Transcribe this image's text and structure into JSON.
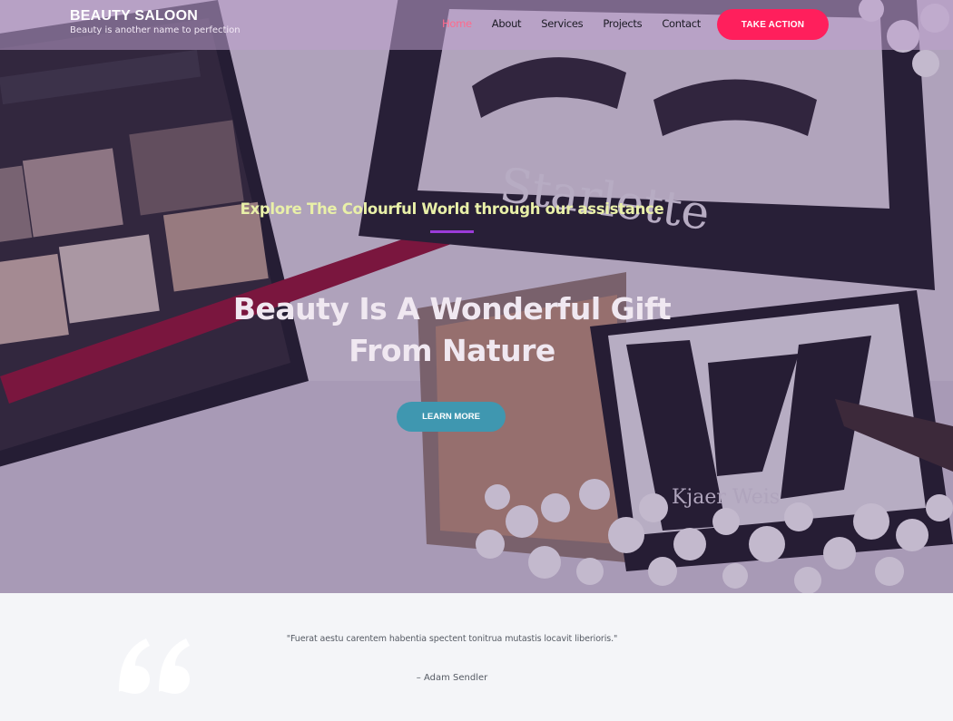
{
  "header": {
    "brand_title": "BEAUTY SALOON",
    "brand_tagline": "Beauty is another name to perfection",
    "nav": [
      {
        "label": "Home",
        "active": true
      },
      {
        "label": "About",
        "active": false
      },
      {
        "label": "Services",
        "active": false
      },
      {
        "label": "Projects",
        "active": false
      },
      {
        "label": "Contact",
        "active": false
      }
    ],
    "cta_label": "TAKE ACTION"
  },
  "hero": {
    "subtitle": "Explore The Colourful World through our assistance",
    "title_line1": "Beauty Is A Wonderful Gift",
    "title_line2": "From Nature",
    "button_label": "LEARN MORE",
    "image_text": {
      "lash_brand": "Starlette",
      "palette_brand": "MODA",
      "compact_brand": "Kjaer Weis"
    }
  },
  "testimonial": {
    "quote": "\"Fuerat aestu carentem habentia spectent tonitrua mutastis locavit liberioris.\"",
    "author": "– Adam Sendler"
  },
  "colors": {
    "accent": "#ff1f5c",
    "nav_active": "#ff6a8c",
    "button_teal": "#3f97b0",
    "divider_purple": "#9b3bd9",
    "subtitle_yellow": "#e9f0a8"
  }
}
